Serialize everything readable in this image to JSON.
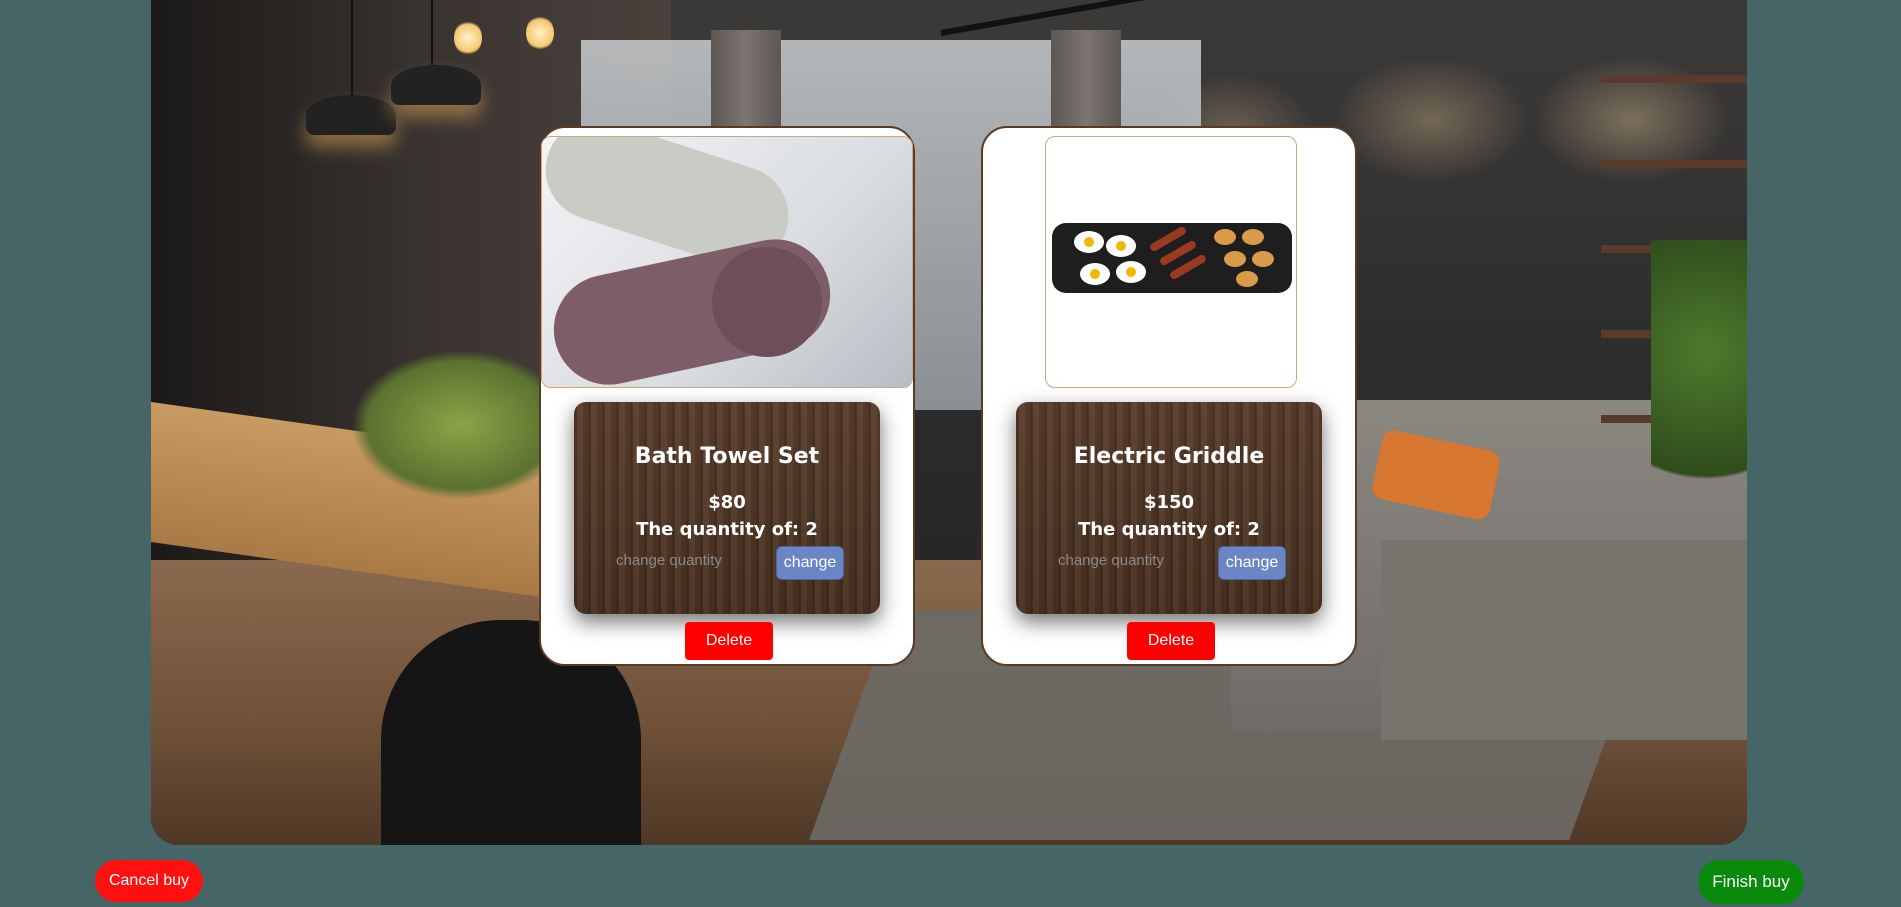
{
  "background": {
    "image": "modern-living-room-dining"
  },
  "cart": {
    "items": [
      {
        "image": "bath-towel-set-photo",
        "title": "Bath Towel Set",
        "price": "$80",
        "quantity_text": "The quantity of: 2",
        "quantity_placeholder": "change quantity",
        "change_label": "change",
        "delete_label": "Delete"
      },
      {
        "image": "electric-griddle-photo",
        "title": "Electric Griddle",
        "price": "$150",
        "quantity_text": "The quantity of: 2",
        "quantity_placeholder": "change quantity",
        "change_label": "change",
        "delete_label": "Delete"
      }
    ]
  },
  "footer": {
    "cancel_label": "Cancel buy",
    "finish_label": "Finish buy"
  },
  "colors": {
    "page_bg": "#456567",
    "delete": "#ff0000",
    "cancel": "#ff1010",
    "finish": "#0a8a0a",
    "change": "#6a86c4"
  }
}
